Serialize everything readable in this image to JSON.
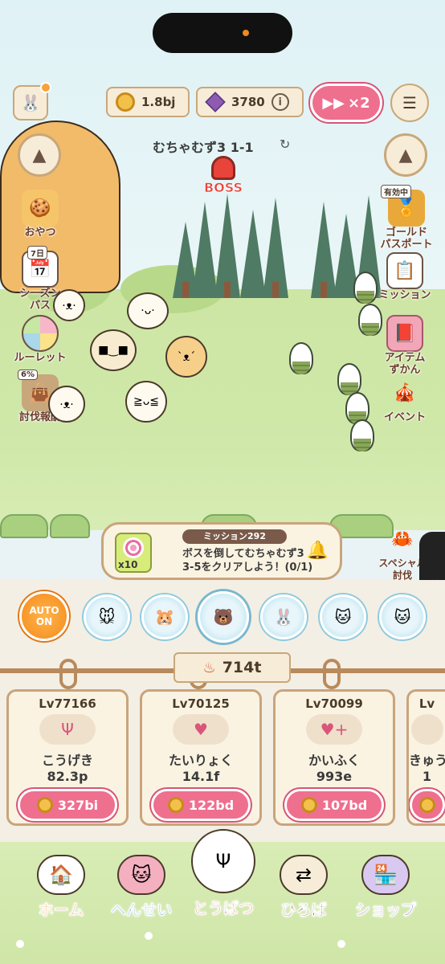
{
  "top_bar": {
    "coins": "1.8bj",
    "gems": "3780",
    "speed_label": "×2",
    "stage": "むちゃむず3 1-1",
    "boss_label": "BOSS"
  },
  "left_menu": [
    {
      "label": "おやつ",
      "tag": ""
    },
    {
      "label": "シーズン\nパス",
      "tag": "7日"
    },
    {
      "label": "ルーレット",
      "tag": ""
    },
    {
      "label": "討伐報酬",
      "tag": "6%"
    }
  ],
  "right_menu": [
    {
      "label": "ゴールド\nパスポート",
      "tag": "有効中"
    },
    {
      "label": "ミッション",
      "tag": ""
    },
    {
      "label": "アイテム\nずかん",
      "tag": ""
    },
    {
      "label": "イベント",
      "tag": ""
    }
  ],
  "mission": {
    "title": "ミッション292",
    "text_line1": "ボスを倒してむちゃむず3",
    "text_line2": "3-5をクリアしよう！(0/1)",
    "reward_count": "x10"
  },
  "special": {
    "label": "スペシャル\n討伐"
  },
  "auto_button": {
    "line1": "AUTO",
    "line2": "ON"
  },
  "power": "714t",
  "upgrades": [
    {
      "level": "Lv77166",
      "name": "こうげき",
      "value": "82.3p",
      "cost": "327bi",
      "icon": "fork-icon"
    },
    {
      "level": "Lv70125",
      "name": "たいりょく",
      "value": "14.1f",
      "cost": "122bd",
      "icon": "heart-icon"
    },
    {
      "level": "Lv70099",
      "name": "かいふく",
      "value": "993e",
      "cost": "107bd",
      "icon": "heart-plus-icon"
    },
    {
      "level": "Lv",
      "name": "きゅう",
      "value": "1",
      "cost": "",
      "icon": "misc-icon"
    }
  ],
  "nav": [
    {
      "label": "ホーム",
      "color": "#f0813a"
    },
    {
      "label": "へんせい",
      "color": "#4d8fd8"
    },
    {
      "label": "とうばつ",
      "color": "#e8564d"
    },
    {
      "label": "ひろば",
      "color": "#6b4a3a"
    },
    {
      "label": "ショップ",
      "color": "#7a55b8"
    }
  ]
}
